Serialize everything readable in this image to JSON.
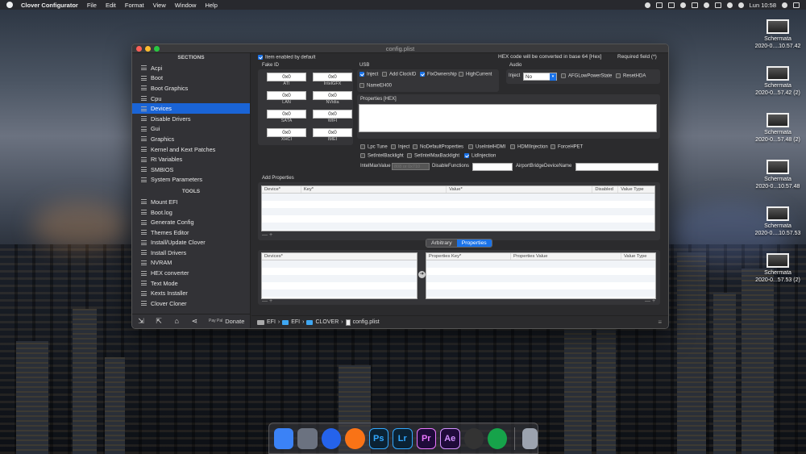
{
  "menubar": {
    "app_name": "Clover Configurator",
    "menus": [
      "File",
      "Edit",
      "Format",
      "View",
      "Window",
      "Help"
    ],
    "clock": "Lun 10:58"
  },
  "desktop_icons": [
    {
      "line1": "Schermata",
      "line2": "2020-0....10.57.42"
    },
    {
      "line1": "Schermata",
      "line2": "2020-0...57.42 (2)"
    },
    {
      "line1": "Schermata",
      "line2": "2020-0...57.48 (2)"
    },
    {
      "line1": "Schermata",
      "line2": "2020-0...10.57.48"
    },
    {
      "line1": "Schermata",
      "line2": "2020-0....10.57.53"
    },
    {
      "line1": "Schermata",
      "line2": "2020-0...57.53 (2)"
    }
  ],
  "window": {
    "title": "config.plist",
    "sections_header": "SECTIONS",
    "sections": [
      "Acpi",
      "Boot",
      "Boot Graphics",
      "Cpu",
      "Devices",
      "Disable Drivers",
      "Gui",
      "Graphics",
      "Kernel and Kext Patches",
      "Rt Variables",
      "SMBIOS",
      "System Parameters"
    ],
    "selected_section": "Devices",
    "tools_header": "TOOLS",
    "tools": [
      "Mount EFI",
      "Boot.log",
      "Generate Config",
      "Themes Editor",
      "Install/Update Clover",
      "Install Drivers",
      "NVRAM",
      "HEX converter",
      "Text Mode",
      "Kexts Installer",
      "Clover Cloner"
    ],
    "donate_label": "Donate",
    "paypal_label": "Pay Pal"
  },
  "main": {
    "item_enabled_label": "Item enabled by default",
    "hex_note": "HEX code will be converted in base 64 [Hex]",
    "required_note": "Required field (*)",
    "fake_id": {
      "title": "Fake ID",
      "fields": [
        {
          "value": "0x0",
          "label": "ATI"
        },
        {
          "value": "0x0",
          "label": "IntelGFX"
        },
        {
          "value": "0x0",
          "label": "LAN"
        },
        {
          "value": "0x0",
          "label": "NVidia"
        },
        {
          "value": "0x0",
          "label": "SATA"
        },
        {
          "value": "0x0",
          "label": "WIFI"
        },
        {
          "value": "0x0",
          "label": "XHCI"
        },
        {
          "value": "0x0",
          "label": "IMEI"
        }
      ]
    },
    "usb": {
      "title": "USB",
      "options": [
        {
          "label": "Inject",
          "checked": true
        },
        {
          "label": "Add ClockID",
          "checked": false
        },
        {
          "label": "FixOwnership",
          "checked": true
        },
        {
          "label": "HighCurrent",
          "checked": false
        },
        {
          "label": "NameEH00",
          "checked": false
        }
      ]
    },
    "audio": {
      "title": "Audio",
      "inject_label": "Inject",
      "inject_value": "No",
      "afg_label": "AFGLowPowerState",
      "reset_label": "ResetHDA"
    },
    "properties_hex_label": "Properties [HEX]",
    "flags_row1": [
      "Lpc Tune",
      "Inject",
      "NoDefaultProperties",
      "UseIntelHDMI",
      "HDMIInjection",
      "ForceHPET"
    ],
    "flags_row2": [
      {
        "label": "SetIntelBacklight",
        "checked": false
      },
      {
        "label": "SetIntelMaxBacklight",
        "checked": false
      },
      {
        "label": "LidInjection",
        "checked": true
      }
    ],
    "intel_max_label": "IntelMaxValue",
    "intel_max_placeholder": "808 or 0x710",
    "disable_functions_label": "DisableFunctions",
    "airport_label": "AirportBridgeDeviceName",
    "add_properties": {
      "title": "Add Properties",
      "columns": [
        "Device*",
        "Key*",
        "Value*",
        "Disabled",
        "Value Type"
      ]
    },
    "tabs": [
      "Arbitrary",
      "Properties"
    ],
    "active_tab": "Properties",
    "devices_table": {
      "columns": [
        "Devices*"
      ]
    },
    "properties_table": {
      "columns": [
        "Properties Key*",
        "Properties Value",
        "Value Type"
      ]
    },
    "path": [
      "EFI",
      "EFI",
      "CLOVER",
      "config.plist"
    ]
  },
  "dock": {
    "apps": [
      {
        "name": "Finder",
        "glyph": "",
        "color": "#3b82f6"
      },
      {
        "name": "Launchpad",
        "glyph": "",
        "color": "#6b7280"
      },
      {
        "name": "Safari",
        "glyph": "",
        "color": "#2563eb"
      },
      {
        "name": "Firefox",
        "glyph": "",
        "color": "#f97316"
      },
      {
        "name": "Photoshop",
        "glyph": "Ps",
        "color": "#0b2233"
      },
      {
        "name": "Lightroom",
        "glyph": "Lr",
        "color": "#0b2233"
      },
      {
        "name": "Premiere Pro",
        "glyph": "Pr",
        "color": "#1f0b3a"
      },
      {
        "name": "After Effects",
        "glyph": "Ae",
        "color": "#1f0b3a"
      },
      {
        "name": "DaVinci Resolve",
        "glyph": "",
        "color": "#333"
      },
      {
        "name": "Globe",
        "glyph": "",
        "color": "#16a34a"
      },
      {
        "name": "Trash",
        "glyph": "",
        "color": "#9ca3af"
      }
    ]
  }
}
